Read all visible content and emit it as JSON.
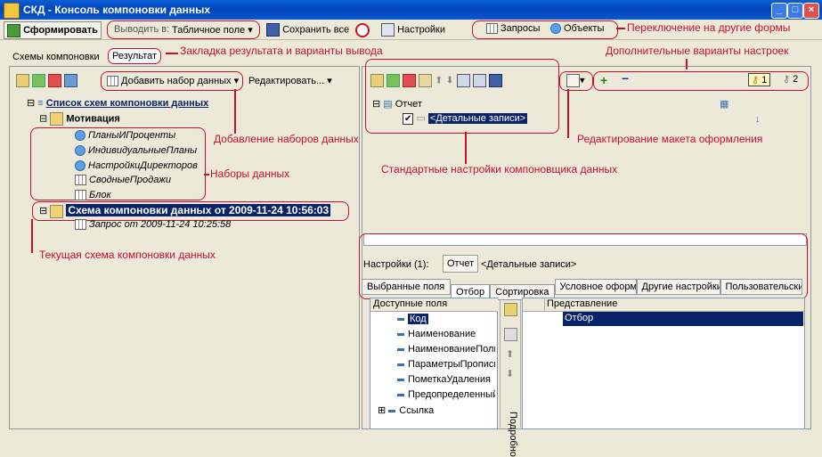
{
  "window": {
    "title": "СКД - Консоль компоновки данных"
  },
  "toolbar": {
    "run": "Сформировать",
    "output_label": "Выводить в:",
    "output_value": "Табличное поле",
    "save_all": "Сохранить все",
    "settings": "Настройки",
    "queries": "Запросы",
    "objects": "Объекты"
  },
  "tabs": {
    "schemes": "Схемы компоновки",
    "result": "Результат"
  },
  "left_toolbar": {
    "add_dataset": "Добавить набор данных",
    "edit": "Редактировать..."
  },
  "tree": {
    "root": "Список схем компоновки данных",
    "motivation": "Мотивация",
    "datasets": [
      "ПланыИПроценты",
      "ИндивидуальныеПланы",
      "НастройкиДиректоров",
      "СводныеПродажи",
      "Блок"
    ],
    "current_scheme": "Схема компоновки данных от 2009-11-24 10:56:03",
    "query": "Запрос от 2009-11-24 10:25:58"
  },
  "right": {
    "report": "Отчет",
    "detail": "<Детальные записи>",
    "settings_label": "Настройки (1):",
    "settings_btn": "Отчет",
    "settings_detail": "<Детальные записи>",
    "variant1": "1",
    "variant2": "2",
    "subtabs": [
      "Выбранные поля",
      "Отбор",
      "Сортировка",
      "Условное оформление",
      "Другие настройки",
      "Пользовательские"
    ],
    "available_header": "Доступные поля",
    "fields": [
      "Код",
      "Наименование",
      "НаименованиеПолное",
      "ПараметрыПрописи",
      "ПометкаУдаления",
      "Предопределенный",
      "Ссылка"
    ],
    "repr_header": "Представление",
    "filter": "Отбор",
    "vertical": "Подробно"
  },
  "annotations": {
    "result_tab": "Закладка результата и варианты вывода",
    "switch_forms": "Переключение на другие формы",
    "extra_settings": "Дополнительные варианты настроек",
    "add_datasets": "Добавление наборов данных",
    "layout_edit": "Редактирование макета оформления",
    "datasets": "Наборы данных",
    "standard_settings": "Стандартные настройки компоновщика данных",
    "current_scheme": "Текущая схема компоновки данных"
  }
}
